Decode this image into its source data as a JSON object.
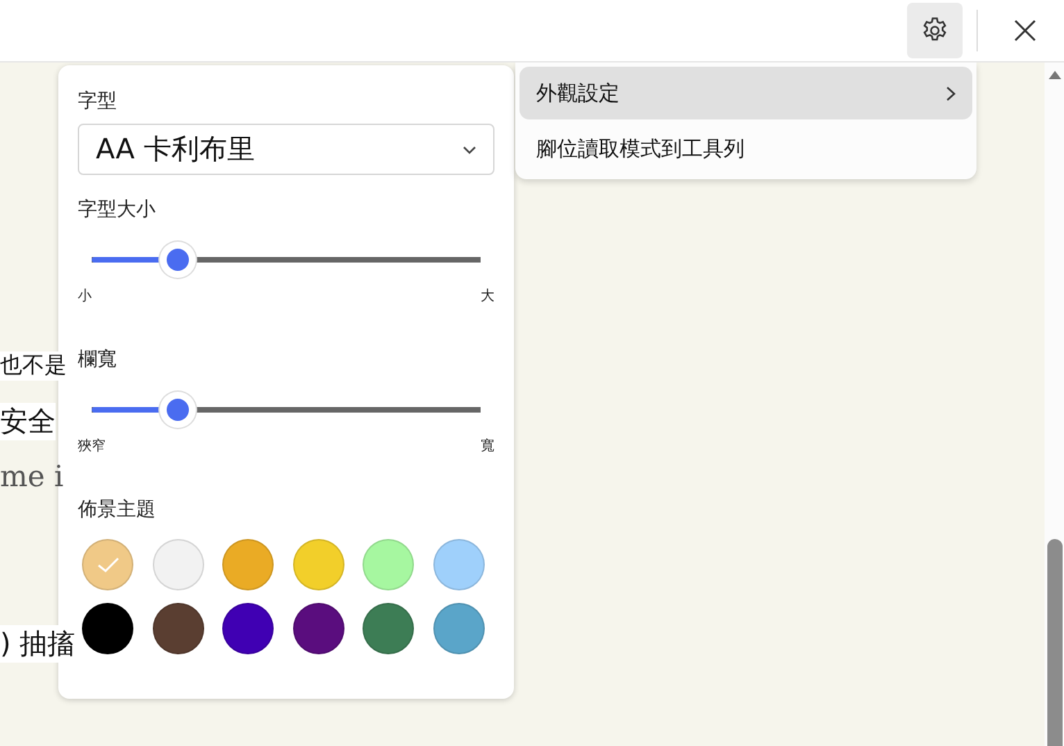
{
  "toolbar": {
    "settings_button": {
      "active": true
    },
    "close_button": {
      "active": false
    }
  },
  "article_fragments": [
    {
      "text": "也不是",
      "kind": "sans"
    },
    {
      "text": "安全",
      "kind": "sans-large"
    },
    {
      "text": "me i",
      "kind": "serif"
    },
    {
      "text": ") 抽搐",
      "kind": "sans-large"
    }
  ],
  "appearance_panel": {
    "font": {
      "label": "字型",
      "value": "AA 卡利布里"
    },
    "font_size": {
      "label": "字型大小",
      "level": 0.22,
      "min_label": "小",
      "max_label": "大"
    },
    "column_width": {
      "label": "欄寬",
      "level": 0.22,
      "min_label": "狹窄",
      "max_label": "寬"
    },
    "theme": {
      "label": "佈景主題",
      "swatches": [
        {
          "color": "#f0c987",
          "selected": true
        },
        {
          "color": "#f2f2f2",
          "selected": false
        },
        {
          "color": "#eaab25",
          "selected": false
        },
        {
          "color": "#f2cf2a",
          "selected": false
        },
        {
          "color": "#a6f7a0",
          "selected": false
        },
        {
          "color": "#9fd0fb",
          "selected": false
        },
        {
          "color": "#000000",
          "selected": false
        },
        {
          "color": "#5a3e31",
          "selected": false
        },
        {
          "color": "#4000b3",
          "selected": false
        },
        {
          "color": "#5a0d7e",
          "selected": false
        },
        {
          "color": "#3d7d55",
          "selected": false
        },
        {
          "color": "#5aa5c9",
          "selected": false
        }
      ]
    }
  },
  "menu": {
    "items": [
      {
        "label": "外觀設定",
        "selected": true,
        "has_submenu": true
      },
      {
        "label": "腳位讀取模式到工具列",
        "selected": false,
        "has_submenu": false
      }
    ]
  }
}
